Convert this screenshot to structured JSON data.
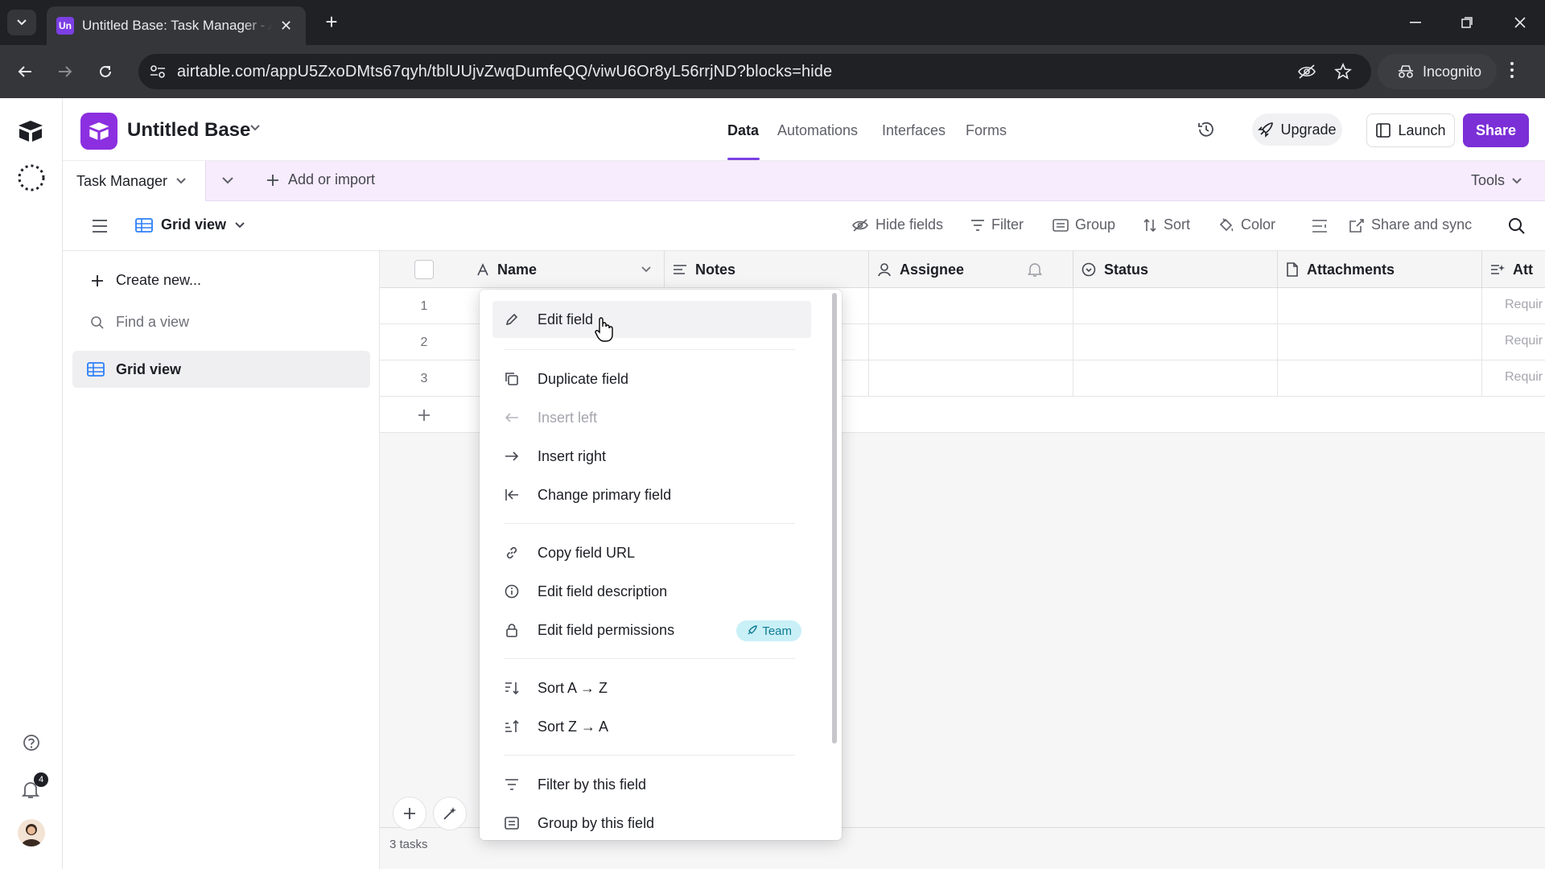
{
  "browser": {
    "tab_favicon": "Un",
    "tab_title": "Untitled Base: Task Manager - Airtable",
    "url": "airtable.com/appU5ZxoDMts67qyh/tblUUjvZwqDumfeQQ/viwU6Or8yL56rrjND?blocks=hide",
    "incognito_label": "Incognito"
  },
  "app": {
    "base_name": "Untitled Base",
    "nav_tabs": [
      "Data",
      "Automations",
      "Interfaces",
      "Forms"
    ],
    "active_tab": "Data",
    "upgrade_label": "Upgrade",
    "launch_label": "Launch",
    "share_label": "Share",
    "accent_color": "#7b2fd6",
    "notification_count": "4"
  },
  "tablebar": {
    "table_name": "Task Manager",
    "add_import_label": "Add or import",
    "tools_label": "Tools"
  },
  "viewbar": {
    "view_name": "Grid view",
    "hide_fields": "Hide fields",
    "filter": "Filter",
    "group": "Group",
    "sort": "Sort",
    "color": "Color",
    "share_sync": "Share and sync"
  },
  "sidebar": {
    "create_new": "Create new...",
    "find_view_placeholder": "Find a view",
    "views": [
      "Grid view"
    ]
  },
  "grid": {
    "columns": [
      "Name",
      "Notes",
      "Assignee",
      "Status",
      "Attachments",
      "Att"
    ],
    "rows": [
      "1",
      "2",
      "3"
    ],
    "required_placeholder": "Requir",
    "record_count": "3 tasks"
  },
  "menu": {
    "items": [
      {
        "label": "Edit field",
        "icon": "pencil-icon"
      },
      {
        "label": "Duplicate field",
        "icon": "duplicate-icon"
      },
      {
        "label": "Insert left",
        "icon": "arrow-left-icon",
        "disabled": true
      },
      {
        "label": "Insert right",
        "icon": "arrow-right-icon"
      },
      {
        "label": "Change primary field",
        "icon": "arrow-to-left-icon"
      },
      {
        "label": "Copy field URL",
        "icon": "link-icon"
      },
      {
        "label": "Edit field description",
        "icon": "info-icon"
      },
      {
        "label": "Edit field permissions",
        "icon": "lock-icon"
      },
      {
        "label": "Sort A → Z",
        "icon": "sort-asc-icon"
      },
      {
        "label": "Sort Z → A",
        "icon": "sort-desc-icon"
      },
      {
        "label": "Filter by this field",
        "icon": "filter-icon"
      },
      {
        "label": "Group by this field",
        "icon": "group-icon"
      }
    ],
    "team_badge": "Team"
  }
}
